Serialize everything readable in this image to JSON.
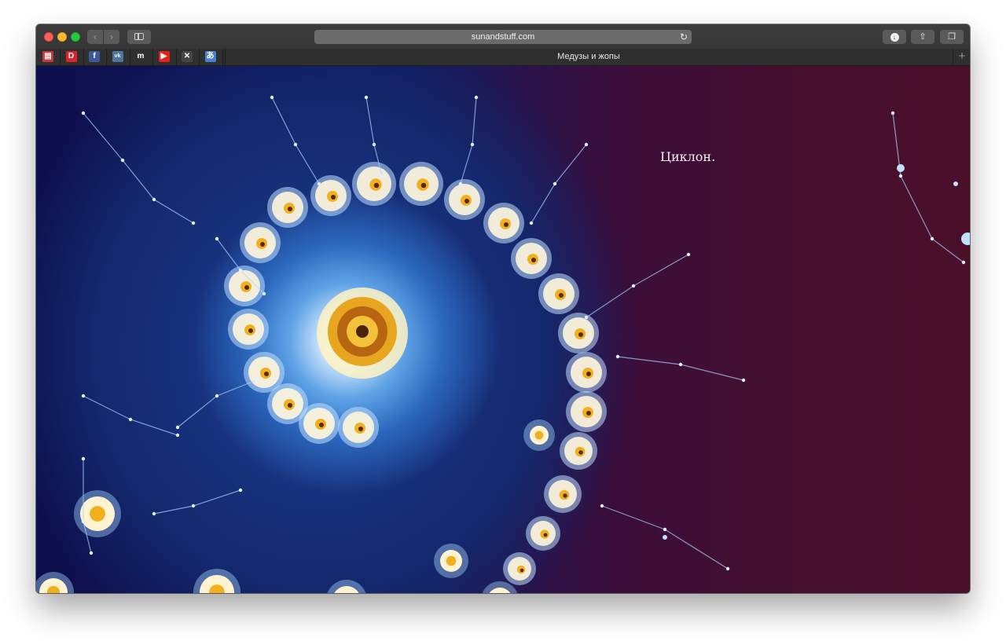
{
  "browser": {
    "url": "sunandstuff.com",
    "active_tab_title": "Медузы и жопы",
    "new_tab_label": "+",
    "nav_back_glyph": "‹",
    "nav_forward_glyph": "›",
    "reload_glyph": "↻",
    "download_glyph": "↓",
    "share_glyph": "⇧",
    "tabs_glyph": "❐"
  },
  "favorites": [
    {
      "name": "favorite-1",
      "icon": "window-icon",
      "color": "#c83a3a",
      "glyph": "▤"
    },
    {
      "name": "favorite-2",
      "icon": "letter-d-icon",
      "color": "#e0202a",
      "glyph": "D"
    },
    {
      "name": "favorite-3",
      "icon": "facebook-icon",
      "color": "#3b5998",
      "glyph": "f"
    },
    {
      "name": "favorite-4",
      "icon": "vk-icon",
      "color": "#4c75a3",
      "glyph": "vk"
    },
    {
      "name": "favorite-5",
      "icon": "letter-m-icon",
      "color": "#2f2f2f",
      "glyph": "m"
    },
    {
      "name": "favorite-6",
      "icon": "youtube-icon",
      "color": "#e62117",
      "glyph": "▶"
    },
    {
      "name": "favorite-7",
      "icon": "pattern-icon",
      "color": "#444444",
      "glyph": "✕"
    },
    {
      "name": "favorite-8",
      "icon": "translate-icon",
      "color": "#4a7fd6",
      "glyph": "あ"
    }
  ],
  "page": {
    "caption": "Циклон."
  },
  "colors": {
    "fractal_deep_blue": "#14195d",
    "fractal_bright_blue": "#5fa3e6",
    "fractal_wine": "#4b0f2a",
    "fractal_gold": "#f0b020"
  }
}
